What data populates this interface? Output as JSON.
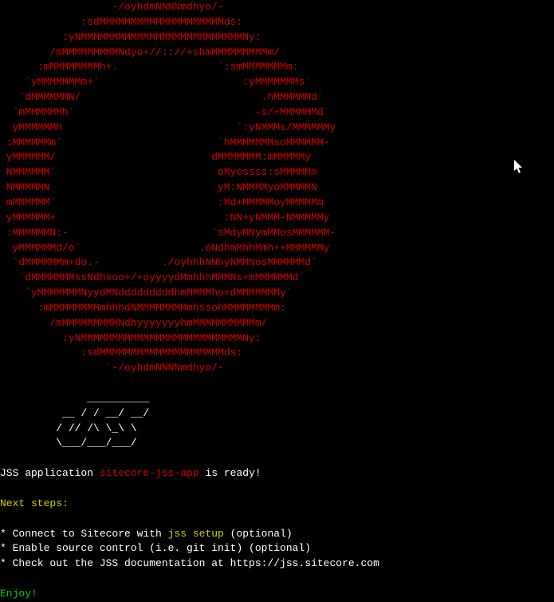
{
  "ascii_logo": "                  -/oyhdmNNNNmdhyo/-\n             :sdMMMMMMMMMMMMMMMMMMMMds:\n          :yNMMMMMMMMMMMMMMMMMMMMMMMMMMNy:\n        /mMMMMMMMMMNdyo+//:://+shmMMMMMMMMMm/\n      :mMMMMMMMMh+.                `:smMMMMMMMm:\n    `yMMMMMMMm+`                       :yMMMMMMMs`\n   `dMMMMMMN/                             .hMMMMMMd`\n  `mMMMMMMh`                             -s/+MMMMMMd`\n  yMMMMMMh                            `:yNMMMs/MMMMMMy\n :MMMMMMm`                         `hMMMMMMMsoMMMMMM-\n yMMMMMM/                         dMMMMMMM:mMMMMMy\n NMMMMMM`                          oMyossss:sMMMMMm\n MMMMMMN                           yM:NMMMMyoMMMMMN\n mMMMMMM`                          :Md+MMMMMoyMMMMMm\n yMMMMMM+                           :NN+yNMMM-NMMMMMy\n :MMMMMMN:-                       `sMdyMNymMMosMMMMMM-\n  yMMMMMMd/o`                   .oNdhmMhhMmh++MMMMMMy\n  `dMMMMMMm+do.-          ./oyhhhNNhyNMMNosMMMMMMd`\n   `dMMMMMMMssNdhsoo+/+oyyyydMmhhhMMMNs+mMMMMMMd`\n    `yMMMMMMMNyydMNdddddddddhmMMMMho+dMMMMMMMy`\n      :mMMMMMMMMmhhhdNMMMMMMMMmhssohMMMMMMMMm:\n        /mMMMMMMMMMNdhyyyyyyyhmMMMMMMMMMMm/\n          :yNMMMMMMMMMMMMMMMMMMMMMMMMMMNy:\n             :sdMMMMMMMMMMMMMMMMMMMMds:\n                 `-/oyhdmNNNNmdhyo/-\n",
  "jss_logo": "\n              __________\n          __ / / __/ __/\n         / // /\\ \\_\\ \\  \n         \\___/___/___/\n",
  "app_ready_prefix": "JSS application ",
  "app_name": "sitecore-jss-app",
  "app_ready_suffix": " is ready!",
  "next_steps_header": "Next steps:",
  "step1_prefix": "* Connect to Sitecore with ",
  "step1_command": "jss setup",
  "step1_suffix": " (optional)",
  "step2": "* Enable source control (i.e. git init) (optional)",
  "step3": "* Check out the JSS documentation at https://jss.sitecore.com",
  "enjoy": "Enjoy!"
}
